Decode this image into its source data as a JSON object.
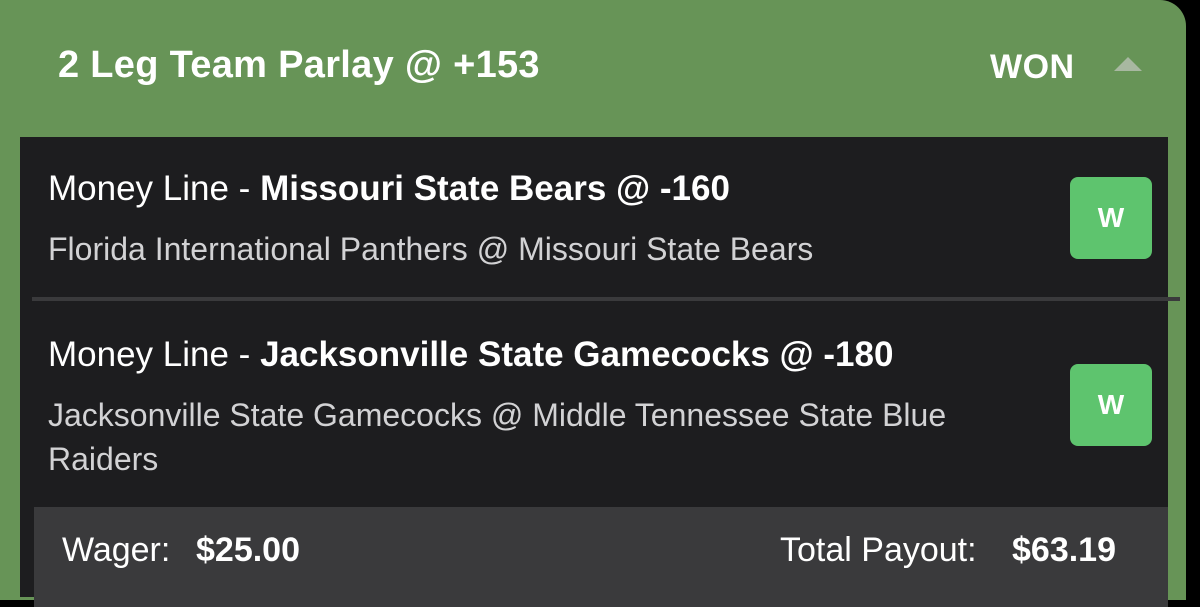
{
  "header": {
    "title": "2 Leg Team Parlay @ +153",
    "status": "WON",
    "toggle_icon": "chevron-up-icon"
  },
  "legs": [
    {
      "prefix": "Money Line - ",
      "pick": "Missouri State Bears @ -160",
      "matchup": "Florida International Panthers @ Missouri State Bears",
      "result": "W"
    },
    {
      "prefix": "Money Line - ",
      "pick": "Jacksonville State Gamecocks @ -180",
      "matchup": "Jacksonville State Gamecocks @ Middle Tennessee State Blue Raiders",
      "result": "W"
    }
  ],
  "footer": {
    "wager_label": "Wager:",
    "wager_value": "$25.00",
    "payout_label": "Total Payout:",
    "payout_value": "$63.19"
  },
  "colors": {
    "header_green": "#679457",
    "win_badge": "#5ec46e",
    "panel": "#1d1d1f",
    "footer": "#3a3a3c"
  }
}
